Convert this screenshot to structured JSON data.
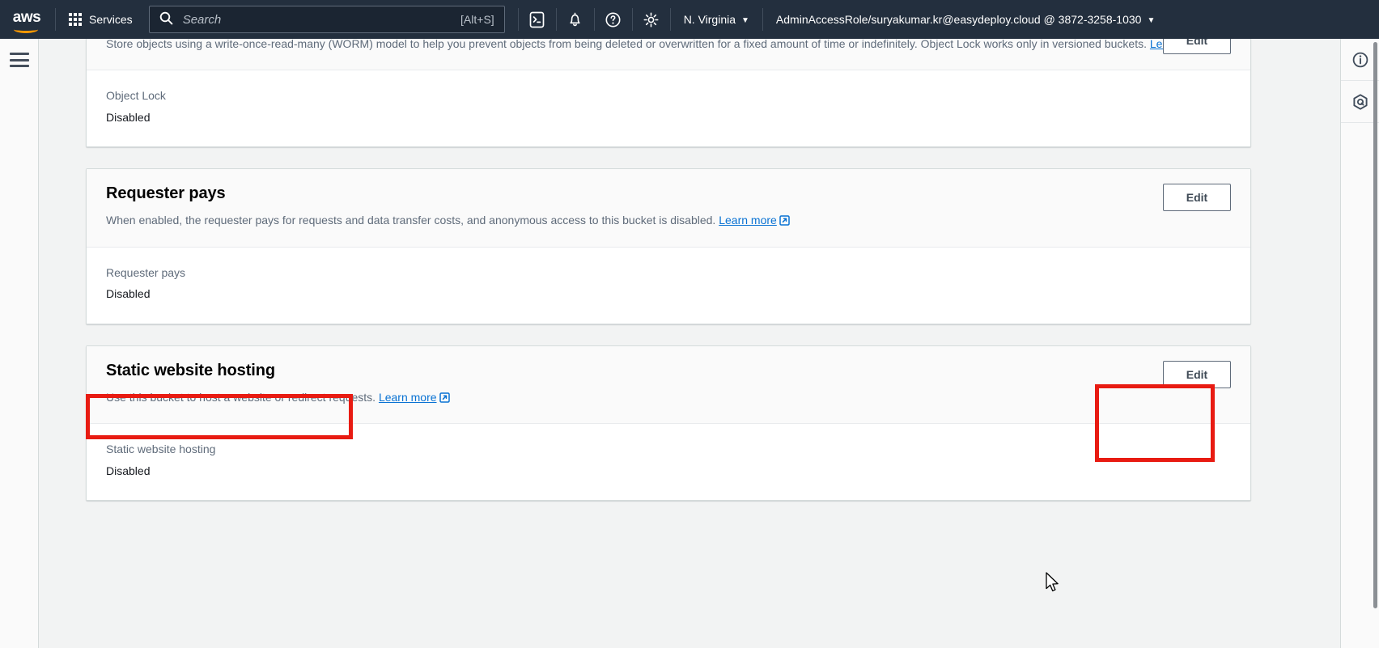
{
  "topnav": {
    "logo_text": "aws",
    "services_label": "Services",
    "search_placeholder": "Search",
    "search_shortcut": "[Alt+S]",
    "icons": [
      "cloudshell-icon",
      "notifications-bell-icon",
      "help-question-icon",
      "settings-gear-icon"
    ],
    "region": "N. Virginia",
    "account": "AdminAccessRole/suryakumar.kr@easydeploy.cloud @ 3872-3258-1030"
  },
  "left_rail": {
    "menu_icon": "hamburger-menu-icon"
  },
  "right_rail": {
    "info_icon": "info-circle-icon",
    "q_icon": "aws-q-hexagon-icon"
  },
  "sections": [
    {
      "id": "object-lock",
      "title": "",
      "description": "Store objects using a write-once-read-many (WORM) model to help you prevent objects from being deleted or overwritten for a fixed amount of time or indefinitely. Object Lock works only in versioned buckets.",
      "learn_more": "Learn more",
      "edit_label": "Edit",
      "field_label": "Object Lock",
      "field_value": "Disabled"
    },
    {
      "id": "requester-pays",
      "title": "Requester pays",
      "description": "When enabled, the requester pays for requests and data transfer costs, and anonymous access to this bucket is disabled.",
      "learn_more": "Learn more",
      "edit_label": "Edit",
      "field_label": "Requester pays",
      "field_value": "Disabled"
    },
    {
      "id": "static-website-hosting",
      "title": "Static website hosting",
      "description": "Use this bucket to host a website or redirect requests.",
      "learn_more": "Learn more",
      "edit_label": "Edit",
      "field_label": "Static website hosting",
      "field_value": "Disabled"
    }
  ],
  "annotations": {
    "color": "#e81b12",
    "boxes": [
      {
        "name": "static-website-hosting-title-highlight"
      },
      {
        "name": "static-website-hosting-edit-highlight"
      }
    ]
  }
}
